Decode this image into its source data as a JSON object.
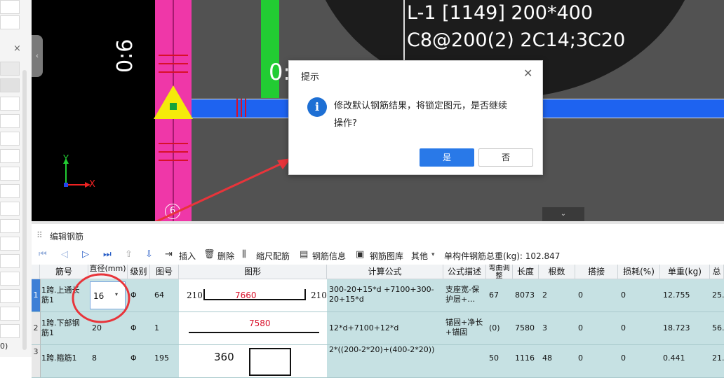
{
  "left_panel": {
    "close_icon": "×",
    "bottom_text": "0)"
  },
  "canvas": {
    "beam_label_line1": "L-1 [1149] 200*400",
    "beam_label_line2": "C8@200(2) 2C14;3C20",
    "rotated_text_1": "0:6",
    "rotated_text_2": "0:",
    "axis_marker": "6",
    "axis_x_label": "X",
    "axis_y_label": "Y",
    "collapse_icon": "chevron-left-icon",
    "bottom_handle_icon": "chevron-down-icon",
    "colors": {
      "column": "#ef37a8",
      "beam": "#1e63f0",
      "green_column": "#22cc33",
      "triangle": "#f5ea0a"
    }
  },
  "dialog": {
    "title": "提示",
    "message_line1": "修改默认钢筋结果，将锁定图元，是否继续",
    "message_line2": "操作?",
    "yes_label": "是",
    "no_label": "否",
    "info_icon": "i"
  },
  "edit_panel": {
    "title": "编辑钢筋",
    "toolbar": {
      "insert": "插入",
      "delete": "删除",
      "scale_rebar": "缩尺配筋",
      "rebar_info": "钢筋信息",
      "rebar_library": "钢筋图库",
      "other": "其他",
      "total_weight": "单构件钢筋总重(kg): 102.847"
    },
    "headers": [
      "筋号",
      "直径(mm)",
      "级别",
      "图号",
      "图形",
      "计算公式",
      "公式描述",
      "弯曲调整",
      "长度",
      "根数",
      "搭接",
      "损耗(%)",
      "单重(kg)",
      "总"
    ],
    "rows": [
      {
        "num": "1",
        "name": "1跨.上通长筋1",
        "diameter": "16",
        "grade": "Φ",
        "fig": "64",
        "shape_left": "210",
        "shape_mid": "7660",
        "shape_right": "210",
        "formula": "300-20+15*d +7100+300-20+15*d",
        "desc": "支座宽-保护层+…",
        "bend": "67",
        "length": "8073",
        "count": "2",
        "lap": "0",
        "loss": "0",
        "unit_weight": "12.755",
        "total": "25."
      },
      {
        "num": "2",
        "name": "1跨.下部钢筋1",
        "diameter": "20",
        "grade": "Φ",
        "fig": "1",
        "shape_left": "",
        "shape_mid": "7580",
        "shape_right": "",
        "formula": "12*d+7100+12*d",
        "desc": "锚固+净长+锚固",
        "bend": "(0)",
        "length": "7580",
        "count": "3",
        "lap": "0",
        "loss": "0",
        "unit_weight": "18.723",
        "total": "56."
      },
      {
        "num": "3",
        "name": "1跨.箍筋1",
        "diameter": "8",
        "grade": "Φ",
        "fig": "195",
        "shape_left": "",
        "shape_mid": "360",
        "shape_right": "",
        "formula": "2*((200-2*20)+(400-2*20))",
        "desc": "",
        "bend": "50",
        "length": "1116",
        "count": "48",
        "lap": "0",
        "loss": "0",
        "unit_weight": "0.441",
        "total": "21."
      }
    ]
  }
}
